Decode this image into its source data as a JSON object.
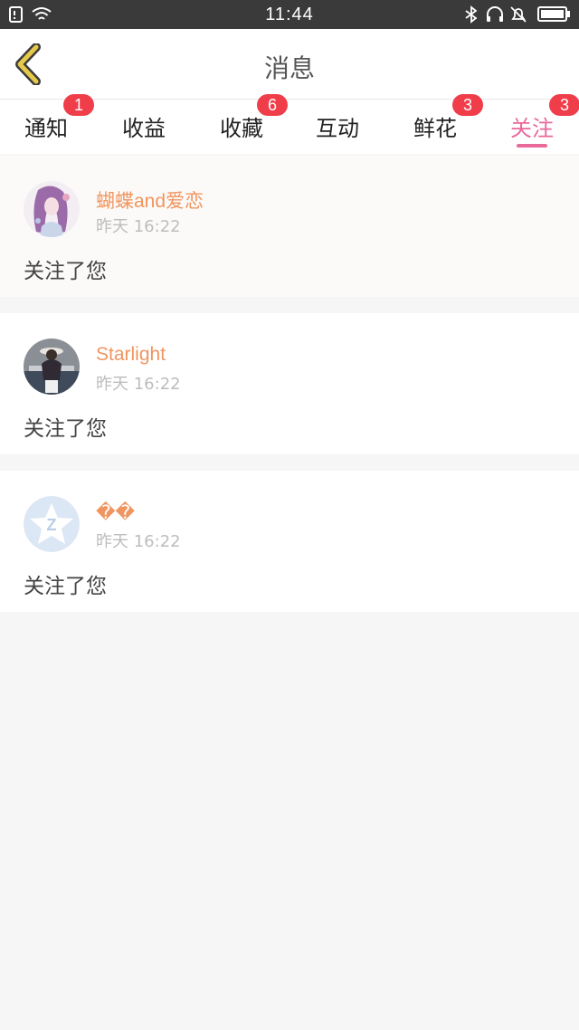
{
  "status_bar": {
    "time": "11:44"
  },
  "header": {
    "title": "消息"
  },
  "tabs": [
    {
      "label": "通知",
      "badge": "1"
    },
    {
      "label": "收益",
      "badge": ""
    },
    {
      "label": "收藏",
      "badge": "6"
    },
    {
      "label": "互动",
      "badge": ""
    },
    {
      "label": "鲜花",
      "badge": "3"
    },
    {
      "label": "关注",
      "badge": "3",
      "active": true
    }
  ],
  "messages": [
    {
      "name": "蝴蝶and爱恋",
      "time": "昨天 16:22",
      "text": "关注了您"
    },
    {
      "name": "Starlight",
      "time": "昨天 16:22",
      "text": "关注了您"
    },
    {
      "name": "��",
      "time": "昨天 16:22",
      "text": "关注了您"
    }
  ],
  "colors": {
    "accent": "#e86a9b",
    "badge": "#f03d4a",
    "username": "#f0955f",
    "back_arrow": "#e6c94a"
  }
}
